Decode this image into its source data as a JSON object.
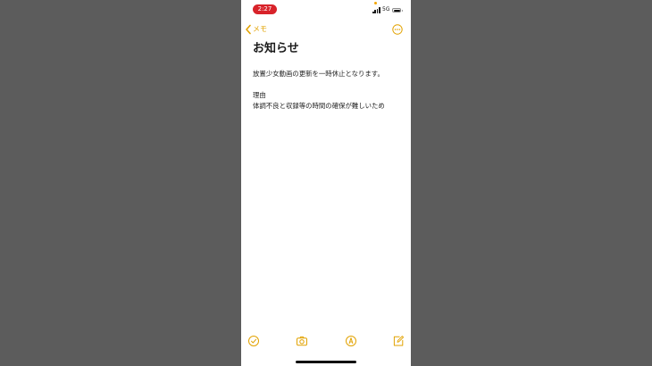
{
  "status_bar": {
    "time": "2:27",
    "network": "5G"
  },
  "nav": {
    "back_label": "メモ"
  },
  "note": {
    "title": "お知らせ",
    "lines": [
      "放置少女動画の更新を一時休止となります。",
      "理由",
      "体調不良と収録等の時間の確保が難しいため"
    ]
  },
  "toolbar": {
    "items": [
      "checklist-icon",
      "camera-icon",
      "markup-icon",
      "compose-icon"
    ]
  },
  "colors": {
    "accent": "#e2a200",
    "time_pill": "#d8232a",
    "background": "#5c5c5c"
  }
}
